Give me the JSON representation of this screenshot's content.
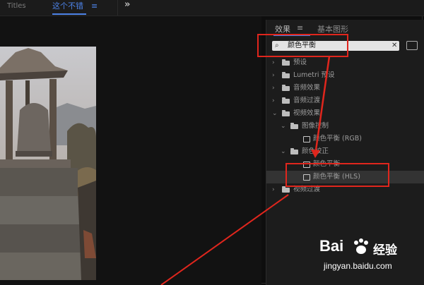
{
  "topbar": {
    "tab_titles": "Titles",
    "tab_active": "这个不错",
    "tab_menu_glyph": "≡",
    "expand_glyph": "»"
  },
  "effects_panel": {
    "tab_effects": "效果",
    "tab_menu_glyph": "≡",
    "tab_graphics": "基本图形",
    "search": {
      "value": "颜色平衡",
      "search_glyph": "⌕",
      "clear_glyph": "✕"
    },
    "tree": [
      {
        "label": "预设",
        "expanded": false,
        "kind": "folder",
        "level": 0
      },
      {
        "label": "Lumetri 预设",
        "expanded": false,
        "kind": "folder",
        "level": 0
      },
      {
        "label": "音频效果",
        "expanded": false,
        "kind": "folder",
        "level": 0
      },
      {
        "label": "音频过渡",
        "expanded": false,
        "kind": "folder",
        "level": 0
      },
      {
        "label": "视频效果",
        "expanded": true,
        "kind": "folder",
        "level": 0
      },
      {
        "label": "图像控制",
        "expanded": true,
        "kind": "folder",
        "level": 1
      },
      {
        "label": "颜色平衡 (RGB)",
        "kind": "effect",
        "level": 2
      },
      {
        "label": "颜色校正",
        "expanded": true,
        "kind": "folder",
        "level": 1
      },
      {
        "label": "颜色平衡",
        "kind": "effect",
        "level": 2
      },
      {
        "label": "颜色平衡 (HLS)",
        "kind": "effect",
        "level": 2,
        "highlighted": true
      },
      {
        "label": "视频过渡",
        "expanded": false,
        "kind": "folder",
        "level": 0
      }
    ]
  },
  "watermark": {
    "logo_left": "Bai",
    "logo_right": "经验",
    "url": "jingyan.baidu.com"
  },
  "colors": {
    "accent_blue": "#4c82e6",
    "annotation_red": "#e0261d",
    "panel_bg": "#1c1c1c",
    "highlight_row": "#333333"
  }
}
